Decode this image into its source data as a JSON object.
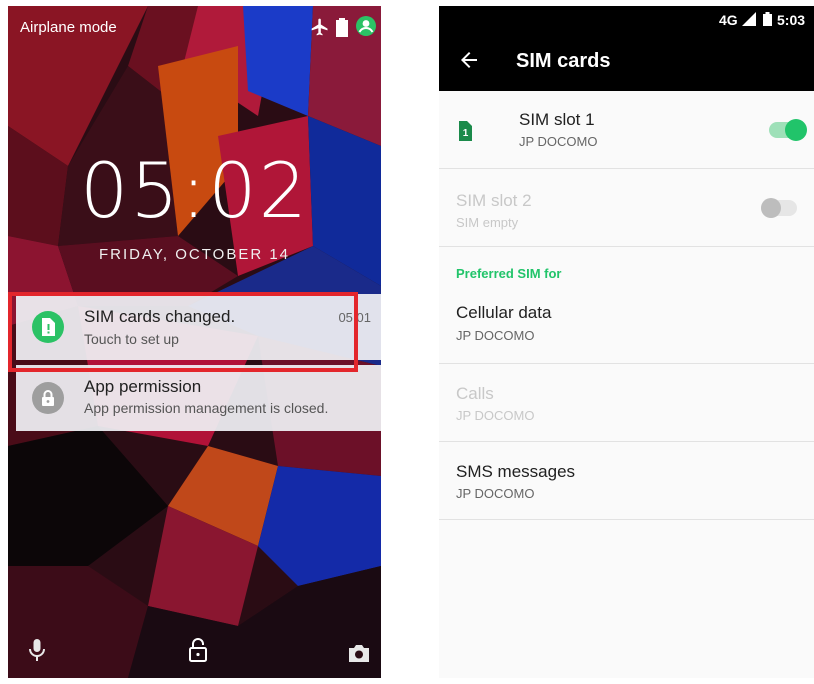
{
  "lockscreen": {
    "status_text": "Airplane mode",
    "status_icons": [
      "airplane-icon",
      "battery-icon",
      "user-account-icon"
    ],
    "accent_color": "#2bc265",
    "clock": "05:02",
    "date": "FRIDAY, OCTOBER 14",
    "notifications": [
      {
        "icon": "sim-alert-icon",
        "title": "SIM cards changed.",
        "text": "Touch to set up",
        "time": "05:01"
      },
      {
        "icon": "lock-icon",
        "title": "App permission",
        "text": "App permission management is closed."
      }
    ],
    "bottom_icons": [
      "microphone-icon",
      "unlock-icon",
      "camera-icon"
    ]
  },
  "sim_settings": {
    "status_bar": {
      "signal": "4G",
      "time": "5:03"
    },
    "title": "SIM cards",
    "slots": [
      {
        "label": "SIM slot 1",
        "carrier": "JP DOCOMO",
        "slot_number": "1",
        "enabled": true
      },
      {
        "label": "SIM slot 2",
        "carrier": "SIM empty",
        "enabled": false
      }
    ],
    "section_header": "Preferred SIM for",
    "preferences": [
      {
        "label": "Cellular data",
        "value": "JP DOCOMO",
        "enabled": true
      },
      {
        "label": "Calls",
        "value": "JP DOCOMO",
        "enabled": false
      },
      {
        "label": "SMS messages",
        "value": "JP DOCOMO",
        "enabled": true
      }
    ],
    "accent_color": "#21c46a"
  }
}
